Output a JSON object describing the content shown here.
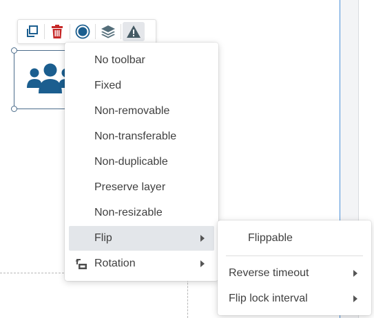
{
  "toolbar": {
    "buttons": [
      {
        "name": "duplicate",
        "icon": "copy-icon",
        "color": "#1b5e8f"
      },
      {
        "name": "delete",
        "icon": "trash-icon",
        "color": "#c62828"
      },
      {
        "name": "record",
        "icon": "record-dot-icon",
        "color": "#1b5e8f"
      },
      {
        "name": "layers",
        "icon": "layers-icon",
        "color": "#546e7a"
      },
      {
        "name": "warning",
        "icon": "warning-icon",
        "color": "#455a64"
      }
    ]
  },
  "widget": {
    "icon": "users-icon",
    "color": "#1b5e8f"
  },
  "context_menu": {
    "items": [
      {
        "label": "No toolbar"
      },
      {
        "label": "Fixed"
      },
      {
        "label": "Non-removable"
      },
      {
        "label": "Non-transferable"
      },
      {
        "label": "Non-duplicable"
      },
      {
        "label": "Preserve layer"
      },
      {
        "label": "Non-resizable"
      },
      {
        "label": "Flip",
        "submenu": true,
        "highlighted": true
      },
      {
        "label": "Rotation",
        "submenu": true,
        "icon": "rotate-icon"
      }
    ]
  },
  "flip_submenu": {
    "items": [
      {
        "label": "Flippable"
      },
      {
        "label": "Reverse timeout",
        "submenu": true
      },
      {
        "label": "Flip lock interval",
        "submenu": true
      }
    ]
  }
}
